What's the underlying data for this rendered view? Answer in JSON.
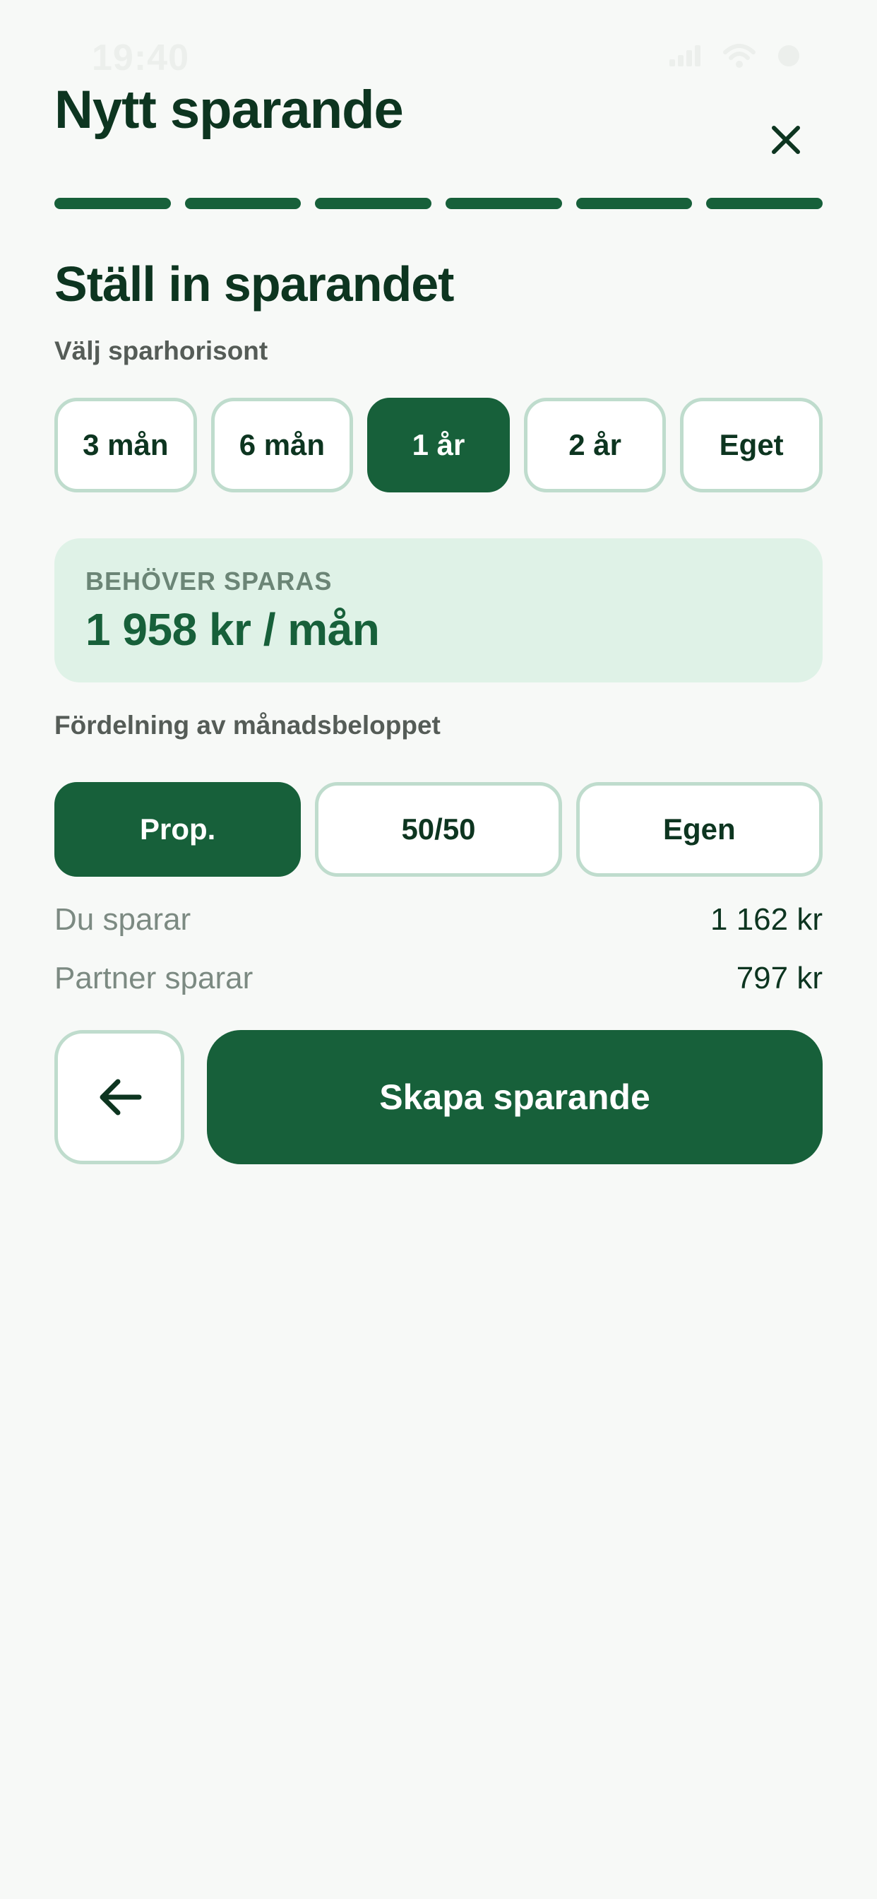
{
  "status_bar": {
    "time": "19:40"
  },
  "header": {
    "title": "Nytt sparande"
  },
  "progress": {
    "steps_total": 6,
    "steps_completed": 6
  },
  "section": {
    "title": "Ställ in sparandet",
    "horizon_label": "Välj sparhorisont",
    "horizon_options": [
      "3 mån",
      "6 mån",
      "1 år",
      "2 år",
      "Eget"
    ],
    "horizon_selected": "1 år"
  },
  "need": {
    "label": "BEHÖVER SPARAS",
    "amount": "1 958 kr / mån"
  },
  "distribution": {
    "label": "Fördelning av månadsbeloppet",
    "options": [
      "Prop.",
      "50/50",
      "Egen"
    ],
    "selected": "Prop."
  },
  "summary": {
    "you_label": "Du sparar",
    "you_value": "1 162 kr",
    "partner_label": "Partner sparar",
    "partner_value": "797 kr"
  },
  "actions": {
    "back_icon": "arrow-left-icon",
    "create_label": "Skapa sparande"
  },
  "colors": {
    "brand_green": "#17603a",
    "light_green_bg": "#dff2e7",
    "chip_border": "#bfdccd",
    "background": "#f7f9f7"
  }
}
